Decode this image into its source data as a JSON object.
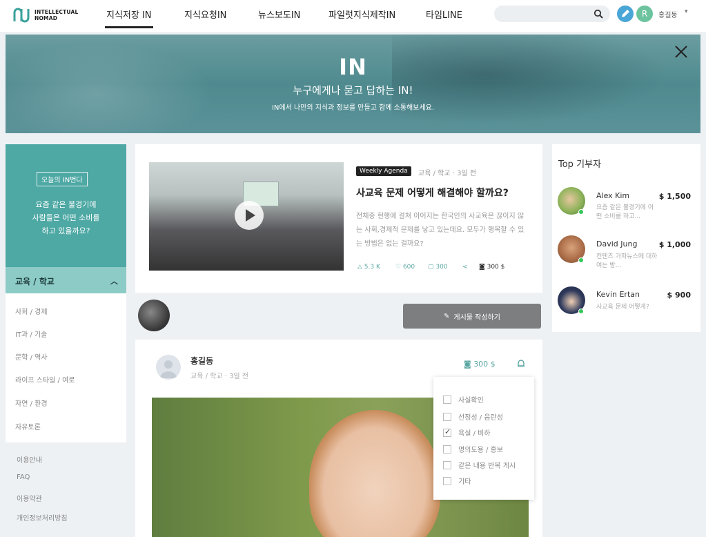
{
  "brand": {
    "line1": "INTELLECTUAL",
    "line2": "NOMAD"
  },
  "nav": {
    "items": [
      "지식저장 IN",
      "지식요청IN",
      "뉴스보도IN",
      "파일럿지식제작IN",
      "타임LINE"
    ],
    "active_index": 0
  },
  "search": {
    "placeholder": ""
  },
  "user": {
    "name": "홍길동",
    "avatar_letter": "R"
  },
  "hero": {
    "logo": "IN",
    "title": "누구에게나 묻고 답하는 IN!",
    "subtitle": "IN에서 나만의 지식과 정보를 만들고 함께 소통해보세요."
  },
  "today": {
    "badge": "오늘의 IN번다",
    "question_lines": [
      "요즘 같은 불경기에",
      "사람들은 어떤 소비를",
      "하고 있을까요?"
    ]
  },
  "categories": {
    "active": "교육 / 학교",
    "items": [
      "사회 / 경제",
      "IT과 / 기술",
      "문학 / 역사",
      "라이프 스타일 / 여로",
      "자연 / 환경",
      "자유토론"
    ]
  },
  "footer_links": [
    "이용안내",
    "FAQ",
    "이용약관",
    "개인정보처리방침"
  ],
  "featured": {
    "tag": "Weekly Agenda",
    "meta": "교육 / 학교  · 3일 전",
    "title": "사교육 문제 어떻게 해결해야 할까요?",
    "description": "전체중 현행에 걸쳐 이어지는 한국인의 사교육은 끊이지 않는 사회,경제적 문제를 낳고 있는데요. 모두가 행복할 수 있는 방법은 없는 걸까요?",
    "stats": {
      "views": "5.3 K",
      "likes": "600",
      "comments": "300",
      "points": "300 $"
    }
  },
  "write_button": "게시물 작성하기",
  "post": {
    "author": "홍길동",
    "meta": "교육 / 학교  · 3일 전",
    "points": "300 $"
  },
  "report_menu": {
    "options": [
      "사실확인",
      "선정성 / 음란성",
      "욕설 / 비하",
      "명의도용 / 홍보",
      "같은 내용 반복 게시",
      "기타"
    ],
    "checked_index": 2
  },
  "donors": {
    "title": "Top 기부자",
    "list": [
      {
        "name": "Alex Kim",
        "amount": "$ 1,500",
        "message": "요즘 같은 불경기에 어떤 소비를 하고..."
      },
      {
        "name": "David Jung",
        "amount": "$ 1,000",
        "message": "컨텐츠 가파뉴스에 대하여는 방..."
      },
      {
        "name": "Kevin Ertan",
        "amount": "$ 900",
        "message": "사교육 문제 어떻게?"
      }
    ]
  },
  "colors": {
    "teal": "#4ea8a4",
    "teal_light": "#8dcbc6",
    "accent_green": "#5aa6a2",
    "online": "#34c759"
  }
}
